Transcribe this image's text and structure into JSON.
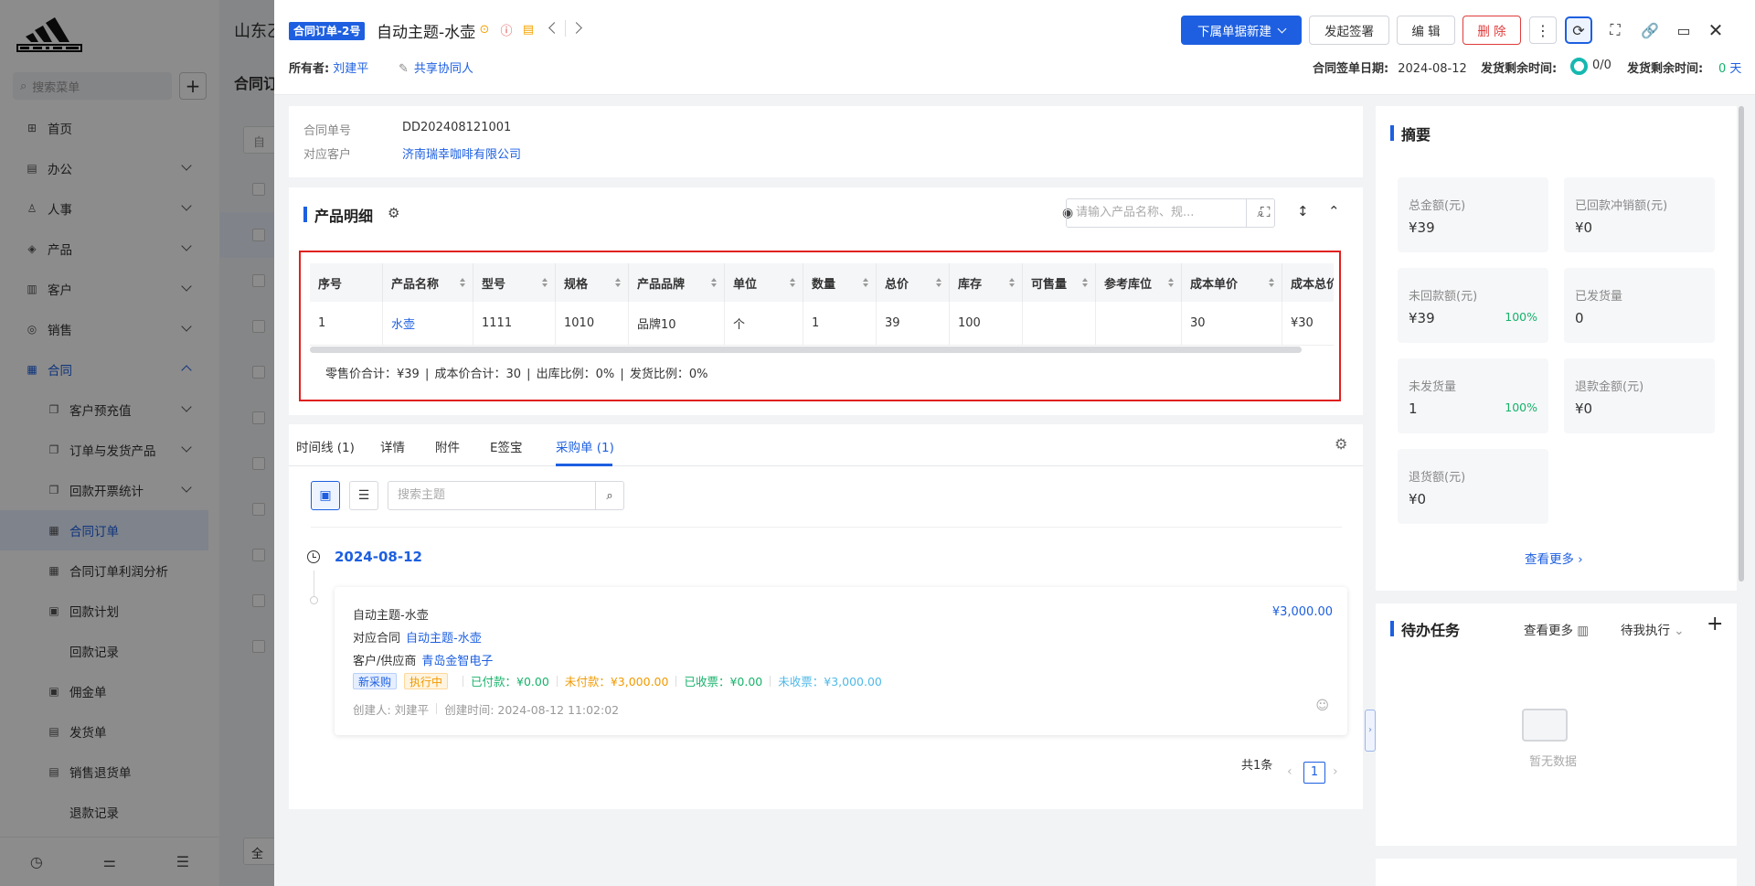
{
  "sidebar": {
    "search_placeholder": "搜索菜单",
    "items": [
      {
        "label": "首页",
        "icon": "home-icon",
        "glyph": "⊞"
      },
      {
        "label": "办公",
        "icon": "office-icon",
        "glyph": "▤"
      },
      {
        "label": "人事",
        "icon": "people-icon",
        "glyph": "♙"
      },
      {
        "label": "产品",
        "icon": "product-icon",
        "glyph": "◈"
      },
      {
        "label": "客户",
        "icon": "customer-icon",
        "glyph": "▥"
      },
      {
        "label": "销售",
        "icon": "sales-icon",
        "glyph": "◎"
      },
      {
        "label": "合同",
        "icon": "contract-icon",
        "glyph": "▦"
      },
      {
        "label": "客户预充值",
        "icon": "prepaid-icon",
        "glyph": "❐"
      },
      {
        "label": "订单与发货产品",
        "icon": "order-icon",
        "glyph": "❐"
      },
      {
        "label": "回款开票统计",
        "icon": "invoice-stat-icon",
        "glyph": "❐"
      },
      {
        "label": "合同订单",
        "icon": "contract-order-icon",
        "glyph": "▦"
      },
      {
        "label": "合同订单利润分析",
        "icon": "profit-icon",
        "glyph": "▦"
      },
      {
        "label": "回款计划",
        "icon": "payback-plan-icon",
        "glyph": "▣"
      },
      {
        "label": "回款记录",
        "icon": "",
        "glyph": ""
      },
      {
        "label": "佣金单",
        "icon": "commission-icon",
        "glyph": "▣"
      },
      {
        "label": "发货单",
        "icon": "delivery-icon",
        "glyph": "▤"
      },
      {
        "label": "销售退货单",
        "icon": "return-icon",
        "glyph": "▤"
      },
      {
        "label": "退款记录",
        "icon": "",
        "glyph": ""
      }
    ]
  },
  "background": {
    "title": "山东乙",
    "subtitle": "合同订",
    "btn": "自",
    "bottom_btn": "全"
  },
  "header": {
    "tag": "合同订单-2号",
    "title": "自动主题-水壶",
    "owner_label": "所有者:",
    "owner": "刘建平",
    "share": "共享协同人",
    "buttons": {
      "new_sub": "下属单据新建",
      "sign": "发起签署",
      "edit": "编 辑",
      "delete": "删 除"
    },
    "sign_date_label": "合同签单日期:",
    "sign_date": "2024-08-12",
    "ship_left_label": "发货剩余时间:",
    "ship_ratio": "0/0",
    "ship_left_label2": "发货剩余时间:",
    "ship_days": "0",
    "ship_days_unit": "天"
  },
  "info": {
    "contract_no_label": "合同单号",
    "contract_no": "DD202408121001",
    "customer_label": "对应客户",
    "customer": "济南瑞幸咖啡有限公司"
  },
  "products": {
    "title": "产品明细",
    "search_placeholder": "请输入产品名称、规...",
    "columns": [
      "序号",
      "产品名称",
      "型号",
      "规格",
      "产品品牌",
      "单位",
      "数量",
      "总价",
      "库存",
      "可售量",
      "参考库位",
      "成本单价",
      "成本总价"
    ],
    "rows": [
      [
        "1",
        "水壶",
        "1111",
        "1010",
        "品牌10",
        "个",
        "1",
        "39",
        "100",
        "",
        "",
        "30",
        "¥30"
      ]
    ],
    "summary": "零售价合计：¥39 |  成本价合计：30 |  出库比例：0% |  发货比例：0%"
  },
  "tabs": [
    {
      "label": "时间线 (1)"
    },
    {
      "label": "详情"
    },
    {
      "label": "附件"
    },
    {
      "label": "E签宝"
    },
    {
      "label": "采购单 (1)"
    }
  ],
  "timeline": {
    "search_placeholder": "搜索主题",
    "date": "2024-08-12",
    "card": {
      "title": "自动主题-水壶",
      "amount": "¥3,000.00",
      "contract_label": "对应合同",
      "contract": "自动主题-水壶",
      "supplier_label": "客户/供应商",
      "supplier": "青岛金智电子",
      "tag_new": "新采购",
      "tag_status": "执行中",
      "paid": "已付款：¥0.00",
      "unpaid": "未付款：¥3,000.00",
      "received_invoice": "已收票：¥0.00",
      "unreceived_invoice": "未收票：¥3,000.00",
      "creator": "创建人: 刘建平",
      "created": "创建时间: 2024-08-12 11:02:02"
    },
    "pager": {
      "total": "共1条",
      "page": "1"
    }
  },
  "summary": {
    "title": "摘要",
    "items": [
      {
        "label": "总金额(元)",
        "value": "¥39",
        "pct": ""
      },
      {
        "label": "已回款冲销额(元)",
        "value": "¥0",
        "pct": ""
      },
      {
        "label": "未回款额(元)",
        "value": "¥39",
        "pct": "100%"
      },
      {
        "label": "已发货量",
        "value": "0",
        "pct": ""
      },
      {
        "label": "未发货量",
        "value": "1",
        "pct": "100%"
      },
      {
        "label": "退款金额(元)",
        "value": "¥0",
        "pct": ""
      },
      {
        "label": "退货额(元)",
        "value": "¥0",
        "pct": ""
      }
    ],
    "more": "查看更多"
  },
  "todo": {
    "title": "待办任务",
    "more": "查看更多",
    "filter": "待我执行",
    "empty": "暂无数据"
  },
  "colors": {
    "accent": "#1d5fe0",
    "danger": "#e03c3c",
    "success": "#17b26a"
  }
}
